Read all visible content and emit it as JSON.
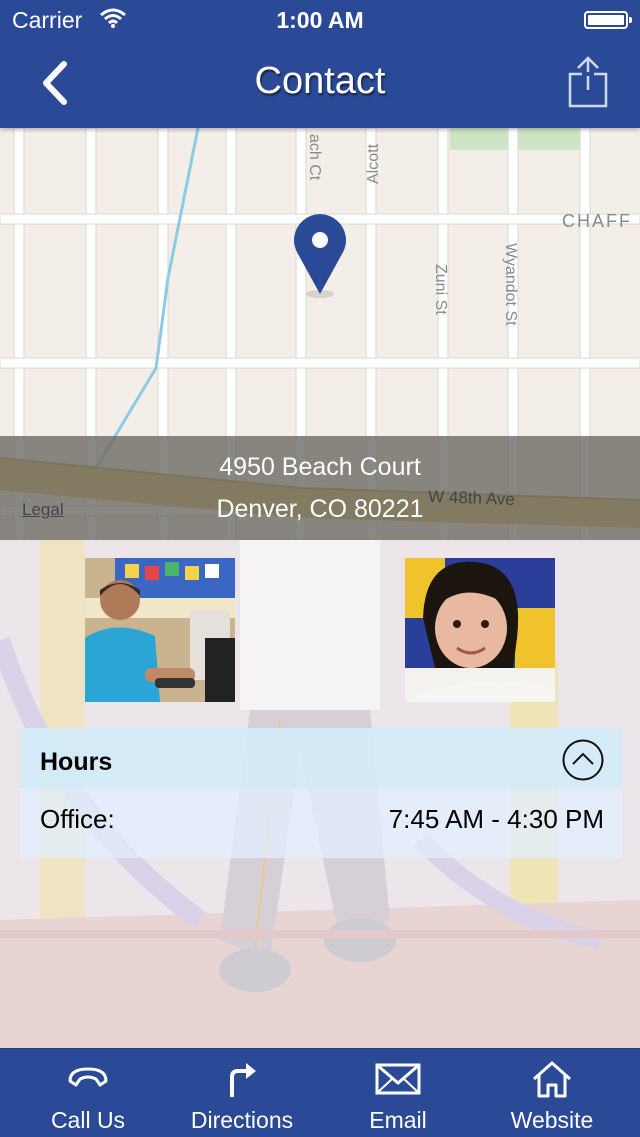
{
  "status_bar": {
    "carrier": "Carrier",
    "time": "1:00 AM"
  },
  "nav": {
    "title": "Contact",
    "back_icon": "chevron-left-icon",
    "share_icon": "share-icon"
  },
  "map": {
    "streets": [
      "ach Ct",
      "Alcott",
      "Zuni St",
      "Wyandot St",
      "CHAFF",
      "W 48th Ave"
    ],
    "legal": "Legal",
    "pin_icon": "map-pin-icon"
  },
  "address": {
    "line1": "4950 Beach Court",
    "line2": "Denver, CO 80221"
  },
  "photos": [
    "boy-at-computer-photo",
    "smiling-girl-photo"
  ],
  "hours": {
    "title": "Hours",
    "toggle_icon": "chevron-up-circle-icon",
    "office_label": "Office:",
    "office_hours": "7:45 AM - 4:30 PM"
  },
  "tabs": [
    {
      "label": "Call Us",
      "icon": "phone-icon"
    },
    {
      "label": "Directions",
      "icon": "turn-right-arrow-icon"
    },
    {
      "label": "Email",
      "icon": "envelope-icon"
    },
    {
      "label": "Website",
      "icon": "home-icon"
    }
  ],
  "colors": {
    "brand_blue": "#2a4a98",
    "map_background": "#f3efe8",
    "highway": "#c9b15a"
  }
}
